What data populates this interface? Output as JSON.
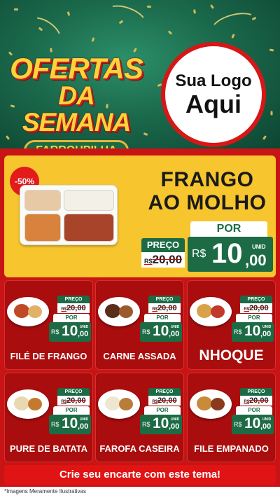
{
  "header": {
    "title_line1": "OFERTAS",
    "title_line2": "DA SEMANA",
    "city": "FARROUPILHA",
    "logo_line1": "Sua Logo",
    "logo_line2": "Aqui"
  },
  "featured": {
    "badge": "-50%",
    "name_line1": "FRANGO",
    "name_line2": "AO MOLHO",
    "preco_label": "PREÇO",
    "old_currency": "R$",
    "old_price": "20,00",
    "por_label": "POR",
    "currency": "R$",
    "price_int": "10",
    "price_dec": ",00",
    "unit": "UNID"
  },
  "products": [
    {
      "name": "FILÉ DE FRANGO",
      "preco_label": "PREÇO",
      "old_currency": "R$",
      "old_price": "20,00",
      "por_label": "POR",
      "currency": "R$",
      "price_int": "10",
      "price_dec": ",00",
      "unit": "UNID"
    },
    {
      "name": "CARNE ASSADA",
      "preco_label": "PREÇO",
      "old_currency": "R$",
      "old_price": "20,00",
      "por_label": "POR",
      "currency": "R$",
      "price_int": "10",
      "price_dec": ",00",
      "unit": "UNID"
    },
    {
      "name": "NHOQUE",
      "preco_label": "PREÇO",
      "old_currency": "R$",
      "old_price": "20,00",
      "por_label": "POR",
      "currency": "R$",
      "price_int": "10",
      "price_dec": ",00",
      "unit": "UNID"
    },
    {
      "name": "PURE DE BATATA",
      "preco_label": "PREÇO",
      "old_currency": "R$",
      "old_price": "20,00",
      "por_label": "POR",
      "currency": "R$",
      "price_int": "10",
      "price_dec": ",00",
      "unit": "UNID"
    },
    {
      "name": "FAROFA CASEIRA",
      "preco_label": "PREÇO",
      "old_currency": "R$",
      "old_price": "20,00",
      "por_label": "POR",
      "currency": "R$",
      "price_int": "10",
      "price_dec": ",00",
      "unit": "UNID"
    },
    {
      "name": "FILE EMPANADO",
      "preco_label": "PREÇO",
      "old_currency": "R$",
      "old_price": "20,00",
      "por_label": "POR",
      "currency": "R$",
      "price_int": "10",
      "price_dec": ",00",
      "unit": "UNID"
    }
  ],
  "footer": {
    "cta": "Crie seu encarte com este tema!",
    "disclaimer": "*Imagens Meramente Ilustrativas"
  },
  "colors": {
    "header_green": "#1b6a4c",
    "band_red": "#c81414",
    "card_red": "#a90d0d",
    "featured_yellow": "#f7c52d",
    "price_green": "#1d6b45",
    "title_yellow": "#ffd23a"
  }
}
